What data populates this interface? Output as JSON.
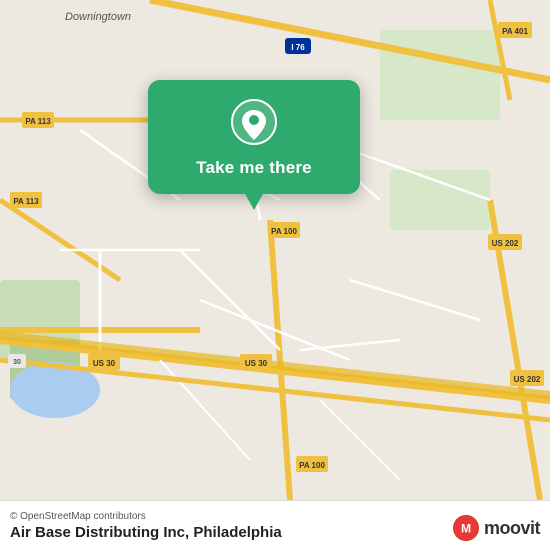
{
  "map": {
    "background_color": "#e8e0d8",
    "attribution": "© OpenStreetMap contributors"
  },
  "popup": {
    "button_label": "Take me there",
    "bg_color": "#2eaa6e"
  },
  "bottom_bar": {
    "place_name": "Air Base Distributing Inc, Philadelphia",
    "attribution": "© OpenStreetMap contributors"
  },
  "moovit": {
    "brand": "moovit"
  }
}
